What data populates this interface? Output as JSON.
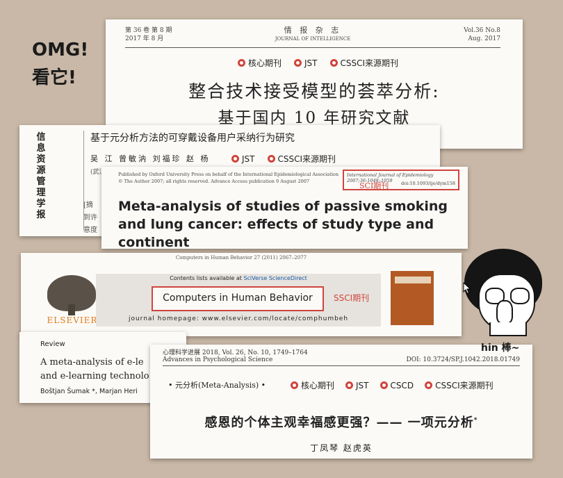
{
  "exclaim": {
    "line1": "OMG!",
    "line2": "看它!"
  },
  "card1": {
    "vol_cn": "第 36 卷 第 8 期",
    "date_cn": "2017 年 8 月",
    "journal_cn": "情 报 杂 志",
    "journal_en": "JOURNAL OF INTELLIGENCE",
    "vol_en": "Vol.36 No.8",
    "date_en": "Aug. 2017",
    "badges": [
      "核心期刊",
      "JST",
      "CSSCI来源期刊"
    ],
    "title1": "整合技术接受模型的荟萃分析:",
    "title2": "基于国内 10 年研究文献"
  },
  "card2": {
    "journal_vertical": [
      "信",
      "息",
      "资",
      "源",
      "管",
      "理",
      "学",
      "报"
    ],
    "title": "基于元分析方法的可穿戴设备用户采纳行为研究",
    "authors": "吴 江 曾敏汭 刘福珍 赵 杨",
    "badges": [
      "JST",
      "CSSCI来源期刊"
    ],
    "aff": "(武汉",
    "frag1": "[摘",
    "frag2": "到许",
    "frag3": "意度"
  },
  "card3": {
    "pub1": "Published by Oxford University Press on behalf of the International Epidemiological Association",
    "pub2": "© The Author 2007; all rights reserved. Advance Access publication 9 August 2007",
    "jref": "International Journal of Epidemiology 2007;36:1048–1059",
    "doi": "doi:10.1093/ije/dym158",
    "sci": "SCI期刊",
    "title": "Meta-analysis of studies of passive smoking and lung cancer: effects of study type and continent"
  },
  "card4": {
    "jline": "Computers in Human Behavior 27 (2011) 2067–2077",
    "contents": "Contents lists available at ",
    "sciverse": "SciVerse ScienceDirect",
    "journal": "Computers in Human Behavior",
    "ssci": "SSCI期刊",
    "homepage": "journal homepage: www.elsevier.com/locate/comphumbeh",
    "publisher": "ELSEVIER"
  },
  "card5": {
    "review": "Review",
    "t1": "A meta-analysis of e-le",
    "t2": "and e-learning technolo",
    "authors": "Boštjan Šumak *, Marjan Heri"
  },
  "card6": {
    "h1": "心理科学进展  2018, Vol. 26, No. 10, 1749–1764",
    "h2": "Advances in Psychological Science",
    "doi": "DOI: 10.3724/SP.J.1042.2018.01749",
    "ma": "• 元分析(Meta-Analysis) •",
    "badges": [
      "核心期刊",
      "JST",
      "CSCD",
      "CSSCI来源期刊"
    ],
    "title": "感恩的个体主观幸福感更强？—— 一项元分析",
    "sup": "*",
    "authors": "丁凤琴   赵虎英"
  },
  "cartoon": {
    "label": "hin 棒~"
  },
  "colors": {
    "background": "#c9b8a7",
    "badge_red": "#d0443c",
    "link_blue": "#1a5aa5",
    "elsevier_orange": "#e07a1a"
  },
  "icons": {
    "badge": "seal-icon",
    "cursor": "mouse-pointer-icon"
  }
}
